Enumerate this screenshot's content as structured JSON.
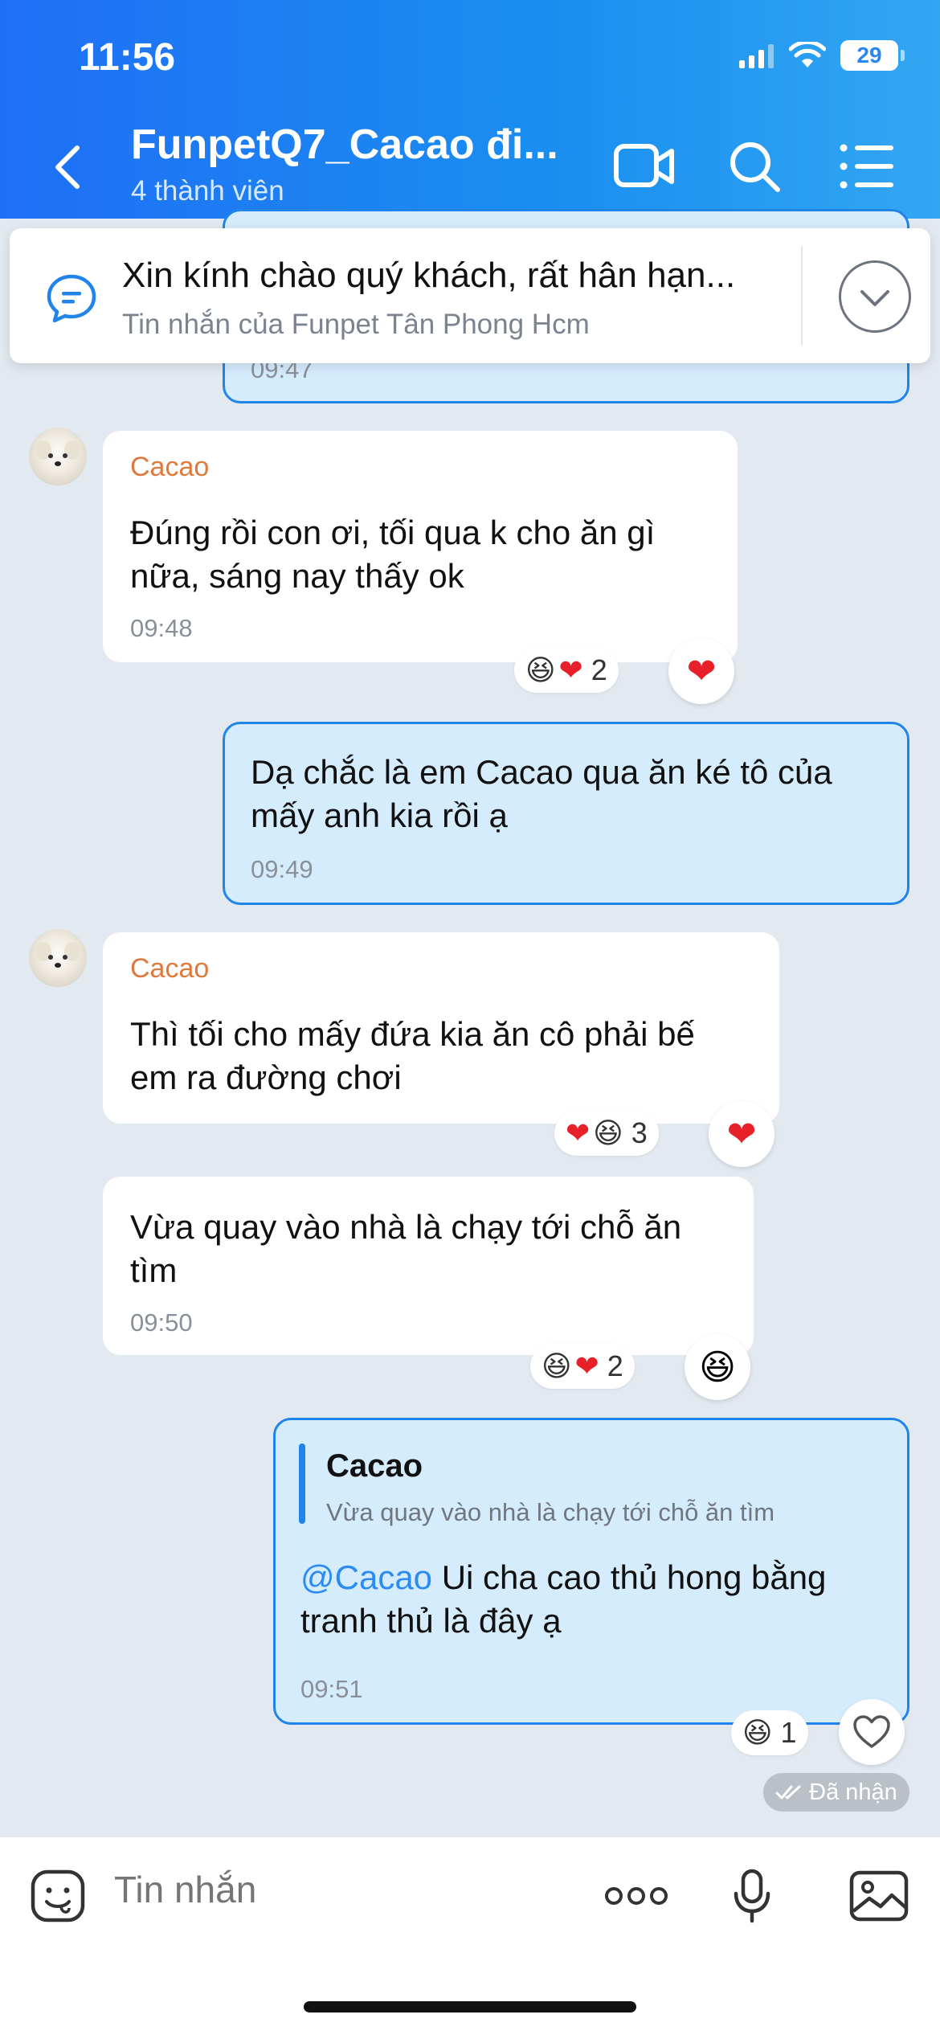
{
  "status": {
    "time": "11:56",
    "battery": "29"
  },
  "header": {
    "title": "FunpetQ7_Cacao đi...",
    "subtitle": "4 thành viên"
  },
  "pinned": {
    "text": "Xin kính chào quý khách, rất hân hạn...",
    "source": "Tin nhắn của Funpet Tân Phong Hcm"
  },
  "messages": {
    "top_partial_time": "09:47",
    "m1": {
      "sender": "Cacao",
      "line1": "Đúng rồi con ơi, tối qua k cho ăn gì",
      "line2": "nữa, sáng nay thấy ok",
      "time": "09:48",
      "reaction_count": "2"
    },
    "m2": {
      "line1": "Dạ chắc là em Cacao qua ăn ké tô của",
      "line2": "mấy anh kia rồi ạ",
      "time": "09:49"
    },
    "m3": {
      "sender": "Cacao",
      "line1": "Thì tối cho mấy đứa kia ăn cô phải bế",
      "line2": "em ra đường chơi",
      "reaction_count": "3"
    },
    "m4": {
      "line1": "Vừa quay vào nhà là chạy tới chỗ ăn",
      "line2": "tìm",
      "time": "09:50",
      "reaction_count": "2"
    },
    "m5": {
      "quote_name": "Cacao",
      "quote_text": "Vừa quay vào nhà là chạy tới chỗ ăn tìm",
      "mention": "@Cacao",
      "line1_rest": " Ui cha cao thủ hong bằng",
      "line2": "tranh thủ là đây ạ",
      "time": "09:51",
      "reaction_count": "1"
    },
    "delivered": "Đã nhận"
  },
  "input": {
    "placeholder": "Tin nhắn"
  },
  "colors": {
    "header_blue": "#1f6ff5",
    "accent": "#2184ea",
    "sender": "#e0793e",
    "chat_bg": "#e2e9f1"
  }
}
